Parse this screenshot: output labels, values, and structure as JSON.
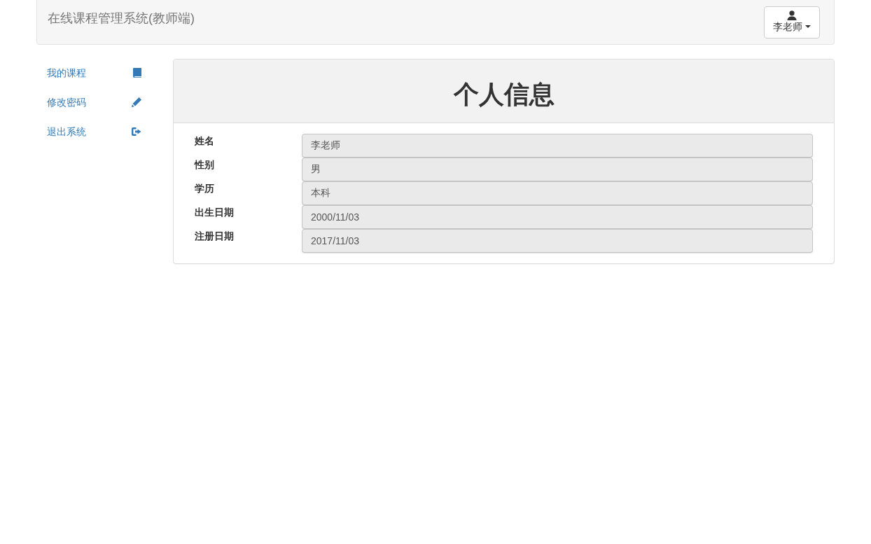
{
  "navbar": {
    "brand": "在线课程管理系统(教师端)",
    "user_menu": {
      "label": "李老师"
    }
  },
  "sidebar": {
    "items": [
      {
        "label": "我的课程"
      },
      {
        "label": "修改密码"
      },
      {
        "label": "退出系统"
      }
    ]
  },
  "panel": {
    "title": "个人信息",
    "fields": [
      {
        "label": "姓名",
        "value": "李老师",
        "disabled": true
      },
      {
        "label": "性别",
        "value": "男",
        "disabled": true
      },
      {
        "label": "学历",
        "value": "本科",
        "disabled": true
      },
      {
        "label": "出生日期",
        "value": "2000/11/03",
        "disabled": true
      },
      {
        "label": "注册日期",
        "value": "2017/11/03",
        "disabled": true
      }
    ]
  }
}
